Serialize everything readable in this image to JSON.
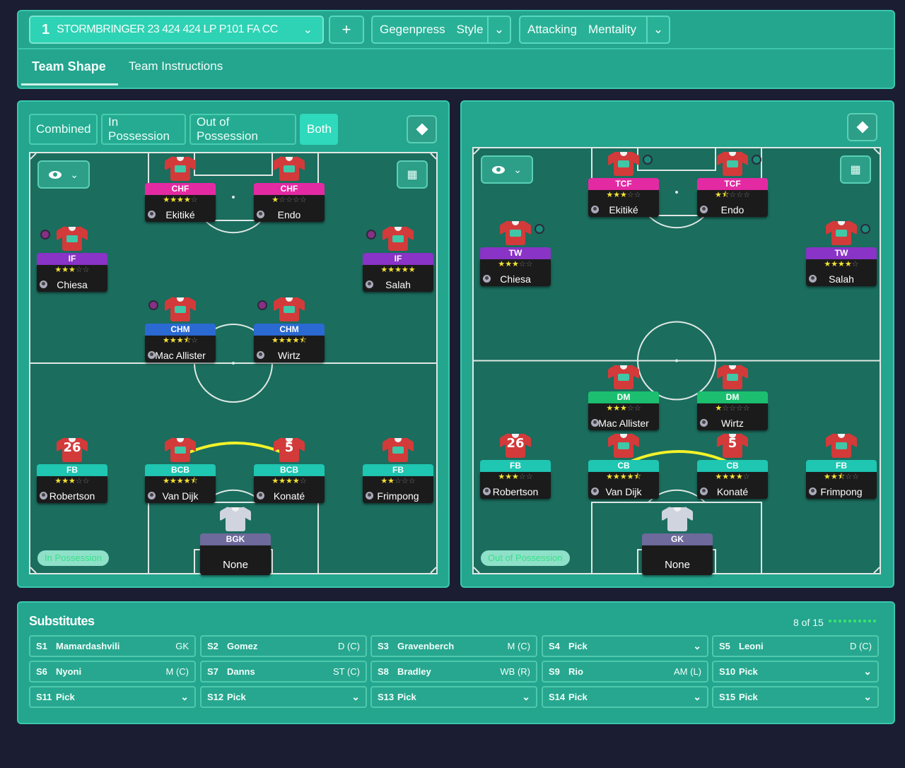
{
  "top": {
    "number": "1",
    "tactic": "STORMBRINGER 23 424 424 LP P101 FA CC",
    "add": "+",
    "style_name": "Gegenpress",
    "style_label": "Style",
    "mentality_name": "Attacking",
    "mentality_label": "Mentality"
  },
  "tabs": [
    "Team Shape",
    "Team Instructions"
  ],
  "views": [
    "Combined",
    "In Possession",
    "Out of Possession",
    "Both"
  ],
  "left": {
    "pill": "In Possession",
    "players": [
      {
        "role": "CHF",
        "name": "Ekitiké",
        "stars": 4,
        "color": "#e42aa3"
      },
      {
        "role": "CHF",
        "name": "Endo",
        "stars": 1,
        "color": "#e42aa3"
      },
      {
        "role": "IF",
        "name": "Chiesa",
        "stars": 3,
        "color": "#8a33c7"
      },
      {
        "role": "IF",
        "name": "Salah",
        "stars": 5,
        "color": "#8a33c7"
      },
      {
        "role": "CHM",
        "name": "Mac Allister",
        "stars": 3.5,
        "color": "#2a6ad2"
      },
      {
        "role": "CHM",
        "name": "Wirtz",
        "stars": 4.5,
        "color": "#2a6ad2"
      },
      {
        "role": "FB",
        "name": "Robertson",
        "stars": 3,
        "color": "#1fc6b1",
        "number": "26"
      },
      {
        "role": "BCB",
        "name": "Van Dijk",
        "stars": 4.5,
        "color": "#1fc6b1"
      },
      {
        "role": "BCB",
        "name": "Konaté",
        "stars": 4,
        "color": "#1fc6b1",
        "number": "5"
      },
      {
        "role": "FB",
        "name": "Frimpong",
        "stars": 2,
        "color": "#1fc6b1"
      },
      {
        "role": "BGK",
        "name": "None",
        "color": "#6e6a9c"
      }
    ]
  },
  "right": {
    "pill": "Out of Possession",
    "players": [
      {
        "role": "TCF",
        "name": "Ekitiké",
        "stars": 3,
        "color": "#e42aa3"
      },
      {
        "role": "TCF",
        "name": "Endo",
        "stars": 1.5,
        "color": "#e42aa3"
      },
      {
        "role": "TW",
        "name": "Chiesa",
        "stars": 3,
        "color": "#8a33c7"
      },
      {
        "role": "TW",
        "name": "Salah",
        "stars": 4,
        "color": "#8a33c7"
      },
      {
        "role": "DM",
        "name": "Mac Allister",
        "stars": 3,
        "color": "#1bbf6f"
      },
      {
        "role": "DM",
        "name": "Wirtz",
        "stars": 1,
        "color": "#1bbf6f"
      },
      {
        "role": "FB",
        "name": "Robertson",
        "stars": 3,
        "color": "#1fc6b1",
        "number": "26"
      },
      {
        "role": "CB",
        "name": "Van Dijk",
        "stars": 4.5,
        "color": "#1fc6b1"
      },
      {
        "role": "CB",
        "name": "Konaté",
        "stars": 4,
        "color": "#1fc6b1",
        "number": "5"
      },
      {
        "role": "FB",
        "name": "Frimpong",
        "stars": 2.5,
        "color": "#1fc6b1"
      },
      {
        "role": "GK",
        "name": "None",
        "color": "#6e6a9c"
      }
    ]
  },
  "subs": {
    "title": "Substitutes",
    "count": "8 of 15",
    "items": [
      {
        "code": "S1",
        "name": "Mamardashvili",
        "pos": "GK"
      },
      {
        "code": "S2",
        "name": "Gomez",
        "pos": "D (C)"
      },
      {
        "code": "S3",
        "name": "Gravenberch",
        "pos": "M (C)"
      },
      {
        "code": "S4",
        "name": "Pick",
        "dropdown": true
      },
      {
        "code": "S5",
        "name": "Leoni",
        "pos": "D (C)"
      },
      {
        "code": "S6",
        "name": "Nyoni",
        "pos": "M (C)"
      },
      {
        "code": "S7",
        "name": "Danns",
        "pos": "ST (C)"
      },
      {
        "code": "S8",
        "name": "Bradley",
        "pos": "WB (R)"
      },
      {
        "code": "S9",
        "name": "Rio",
        "pos": "AM (L)"
      },
      {
        "code": "S10",
        "name": "Pick",
        "dropdown": true
      },
      {
        "code": "S11",
        "name": "Pick",
        "dropdown": true
      },
      {
        "code": "S12",
        "name": "Pick",
        "dropdown": true
      },
      {
        "code": "S13",
        "name": "Pick",
        "dropdown": true
      },
      {
        "code": "S14",
        "name": "Pick",
        "dropdown": true
      },
      {
        "code": "S15",
        "name": "Pick",
        "dropdown": true
      }
    ]
  },
  "icons": {
    "chevron": "chevron-down-icon",
    "eye": "eye-icon",
    "grid": "grid-icon",
    "diamond": "diamond-icon",
    "person": "person-icon",
    "shirt": "shirt-icon"
  }
}
